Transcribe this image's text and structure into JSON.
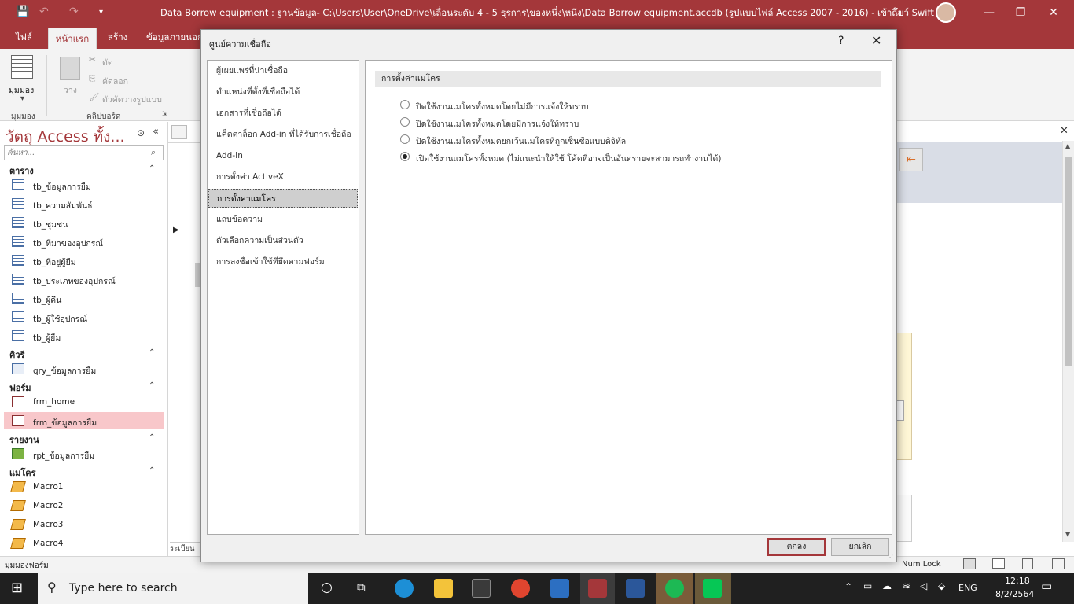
{
  "window": {
    "title": "Data Borrow equipment : ฐานข้อมูล- C:\\Users\\User\\OneDrive\\เลื่อนระดับ 4 - 5 ธุรการ\\ของหนึ่ง\\หนึ่ง\\Data Borrow equipment.accdb (รูปแบบไฟล์ Access 2007 - 2016) - เข้าถึง",
    "user": "โบว์ Swift",
    "minimize": "—",
    "restore": "❐",
    "close": "✕"
  },
  "ribbon": {
    "tabs": [
      "ไฟล์",
      "หน้าแรก",
      "สร้าง",
      "ข้อมูลภายนอก"
    ],
    "view_label": "มุมมอง",
    "view_group": "มุมมอง",
    "paste_label": "วาง",
    "cut_label": "ตัด",
    "copy_label": "คัดลอก",
    "format_painter_label": "ตัวคัดวางรูปแบบ",
    "clipboard_group": "คลิปบอร์ด"
  },
  "nav": {
    "title": "วัตถุ Access ทั้ง...",
    "search_placeholder": "ค้นหา...",
    "groups": {
      "tables": "ตาราง",
      "queries": "คิวรี",
      "forms": "ฟอร์ม",
      "reports": "รายงาน",
      "macros": "แมโคร"
    },
    "tables": [
      "tb_ข้อมูลการยืม",
      "tb_ความสัมพันธ์",
      "tb_ชุมชน",
      "tb_ที่มาของอุปกรณ์",
      "tb_ที่อยู่ผู้ยืม",
      "tb_ประเภทของอุปกรณ์",
      "tb_ผู้คืน",
      "tb_ผู้ใช้อุปกรณ์",
      "tb_ผู้ยืม"
    ],
    "queries": [
      "qry_ข้อมูลการยืม"
    ],
    "forms": [
      "frm_home",
      "frm_ข้อมูลการยืม"
    ],
    "reports": [
      "rpt_ข้อมูลการยืม"
    ],
    "macros": [
      "Macro1",
      "Macro2",
      "Macro3",
      "Macro4"
    ]
  },
  "status": {
    "left": "มุมมองฟอร์ม",
    "num_lock": "Num Lock",
    "record_nav": "ระเบียน"
  },
  "taskbar": {
    "search_placeholder": "Type here to search",
    "lang": "ENG",
    "time": "12:18",
    "date": "8/2/2564"
  },
  "dialog": {
    "title": "ศูนย์ความเชื่อถือ",
    "help": "?",
    "close": "✕",
    "categories": [
      "ผู้เผยแพร่ที่น่าเชื่อถือ",
      "ตำแหน่งที่ตั้งที่เชื่อถือได้",
      "เอกสารที่เชื่อถือได้",
      "แค็ตตาล็อก Add-in ที่ได้รับการเชื่อถือ",
      "Add-In",
      "การตั้งค่า ActiveX",
      "การตั้งค่าแมโคร",
      "แถบข้อความ",
      "ตัวเลือกความเป็นส่วนตัว",
      "การลงชื่อเข้าใช้ที่ยึดตามฟอร์ม"
    ],
    "selected_category_index": 6,
    "section_header": "การตั้งค่าแมโคร",
    "options": [
      "ปิดใช้งานแมโครทั้งหมดโดยไม่มีการแจ้งให้ทราบ",
      "ปิดใช้งานแมโครทั้งหมดโดยมีการแจ้งให้ทราบ",
      "ปิดใช้งานแมโครทั้งหมดยกเว้นแมโครที่ถูกเซ็นชื่อแบบดิจิทัล",
      "เปิดใช้งานแมโครทั้งหมด (ไม่แนะนำให้ใช้ โค้ดที่อาจเป็นอันตรายจะสามารถทำงานได้)"
    ],
    "selected_option_index": 3,
    "ok_label": "ตกลง",
    "cancel_label": "ยกเลิก"
  }
}
